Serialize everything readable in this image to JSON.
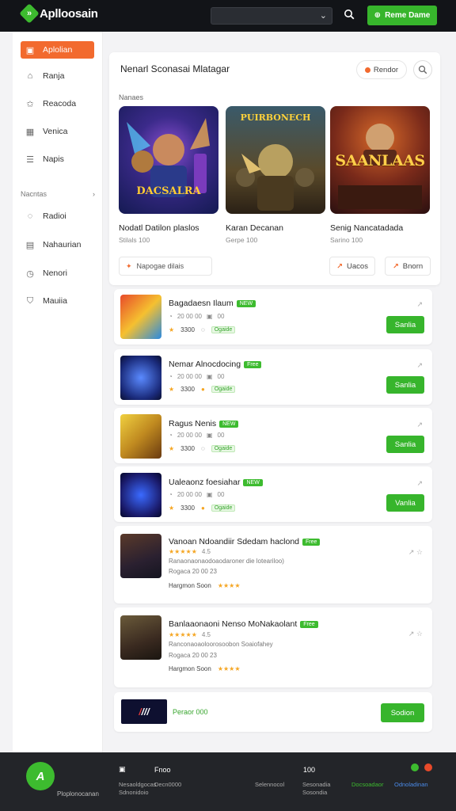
{
  "header": {
    "brand": "Aplloosain",
    "cta_label": "Reme Dame",
    "search_placeholder": ""
  },
  "sidebar": {
    "items": [
      {
        "label": "Aplolian",
        "icon": "app-icon"
      },
      {
        "label": "Ranja",
        "icon": "home-icon"
      },
      {
        "label": "Reacoda",
        "icon": "star-icon"
      },
      {
        "label": "Venica",
        "icon": "grid-icon"
      },
      {
        "label": "Napis",
        "icon": "list-icon"
      }
    ],
    "section_label": "Nacntas",
    "section_items": [
      {
        "label": "Radioi",
        "icon": "chat-icon"
      },
      {
        "label": "Nahaurian",
        "icon": "book-icon"
      },
      {
        "label": "Nenori",
        "icon": "clock-icon"
      },
      {
        "label": "Mauiia",
        "icon": "shield-icon"
      }
    ]
  },
  "featured": {
    "title": "Nenarl Sconasai Mlatagar",
    "pill_label": "Rendor",
    "section_label": "Nanaes",
    "cards": [
      {
        "title": "Nodatl Datilon plaslos",
        "sub": "Stilals 100",
        "art_text": "DACSALRA"
      },
      {
        "title": "Karan Decanan",
        "sub": "Gerpe 100",
        "art_text": "PUIRBONECH"
      },
      {
        "title": "Senig Nancatadada",
        "sub": "Sarino 100",
        "art_text": "SAANLAAS"
      }
    ],
    "footer_left": "Napogae dilais",
    "footer_btn1": "Uacos",
    "footer_btn2": "Bnorn"
  },
  "list": [
    {
      "title": "Bagadaesn Ilaum",
      "badge": "NEW",
      "meta1": "20 00 00",
      "meta2": "00",
      "score": "3300",
      "tag": "Ogaide",
      "btn": "Sanlia"
    },
    {
      "title": "Nemar Alnocdocing",
      "badge": "Free",
      "meta1": "20 00 00",
      "meta2": "00",
      "score": "3300",
      "tag": "Ogaide",
      "btn": "Sanlia"
    },
    {
      "title": "Ragus Nenis",
      "badge": "NEW",
      "meta1": "20 00 00",
      "meta2": "00",
      "score": "3300",
      "tag": "Ogaide",
      "btn": "Sanlia"
    },
    {
      "title": "Ualeaonz foesiahar",
      "badge": "NEW",
      "meta1": "20 00 00",
      "meta2": "00",
      "score": "3300",
      "tag": "Ogaide",
      "btn": "Vanlia"
    }
  ],
  "list_large": [
    {
      "title": "Vanoan Ndoandiir Sdedam haclond",
      "badge": "Free",
      "rating": "4.5",
      "desc": "Ranaonaonaodoaodaroner die loteariloo)",
      "stats": "Rogaca 20 00   23",
      "footer": "Hargmon Soon"
    },
    {
      "title": "Banlaaonaoni Nenso MoNakaolant",
      "badge": "Free",
      "rating": "4.5",
      "desc": "Ranconaoaoloorosoobon Soaiofahey",
      "stats": "Rogaca 20 00   23",
      "footer": "Hargmon Soon"
    }
  ],
  "promo": {
    "label": "Peraor 000",
    "btn": "Sodion"
  },
  "footer": {
    "logo_text": "Ploplonocanan",
    "col1_head": "Fnoo",
    "col1_a": "Nesaoldgocas",
    "col1_b": "Sdnonidoio",
    "col1_c": "Decn0000",
    "col2_head": "100",
    "col2_a": "Sesonadia",
    "col2_b": "Sosondia",
    "col3": "Selennocol",
    "col4": "Docsoadaor",
    "col5": "Odnoladinan"
  },
  "colors": {
    "accent_orange": "#f26a2e",
    "accent_green": "#37b52c",
    "header_bg": "#121418"
  }
}
